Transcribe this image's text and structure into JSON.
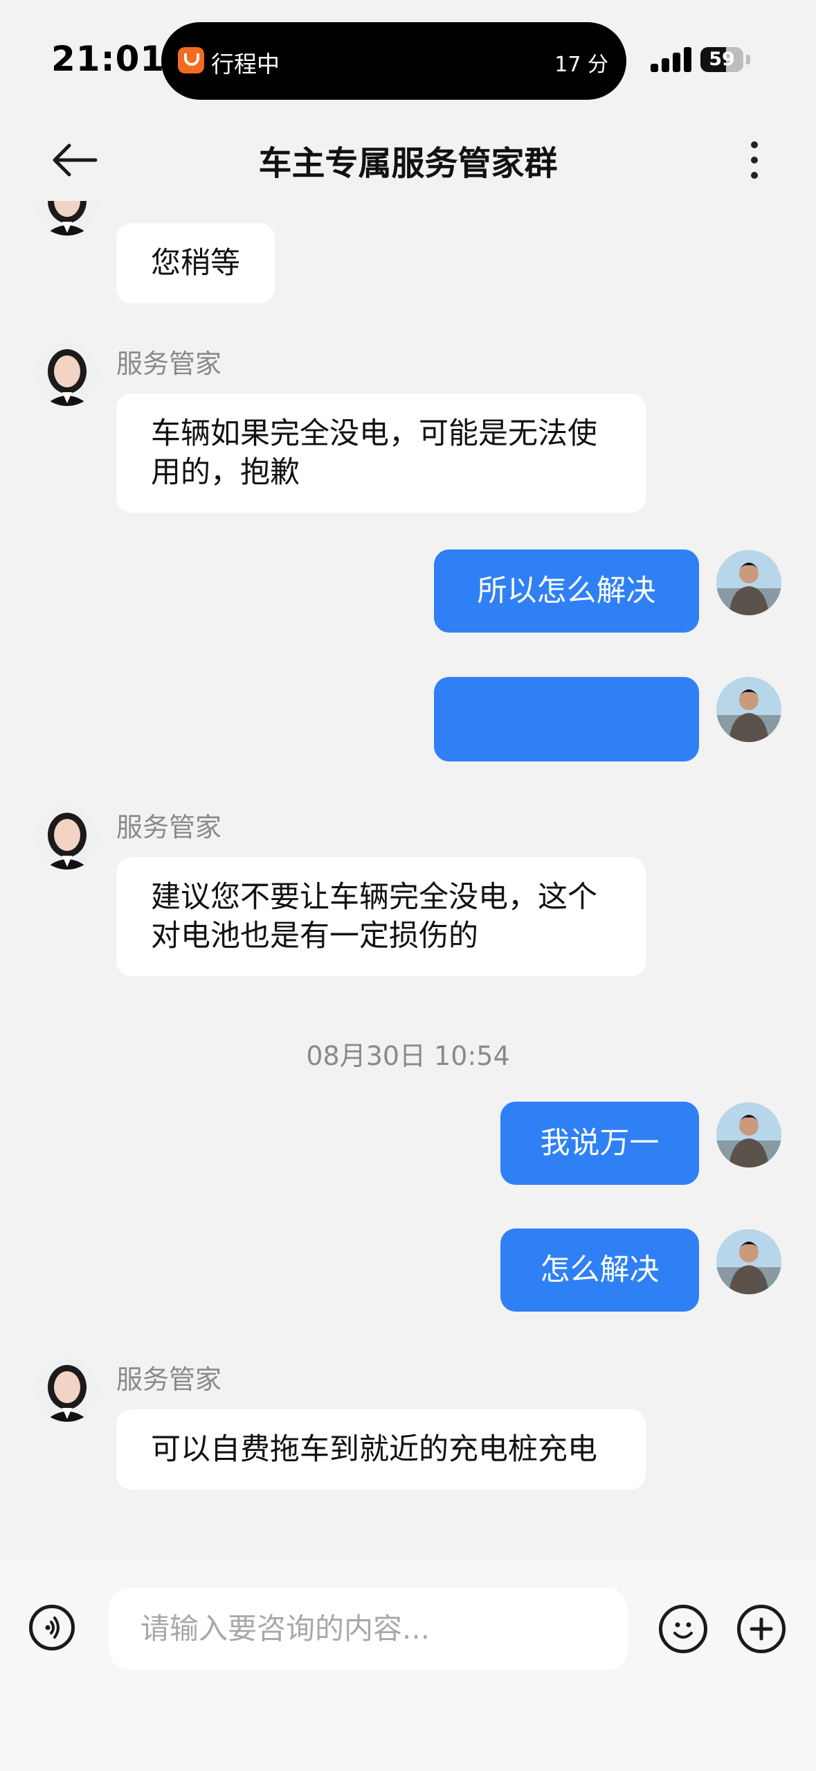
{
  "status_bar": {
    "time": "21:01",
    "activity": "行程中",
    "activity_time": "17 分",
    "battery": "59",
    "battery_level": 0.59
  },
  "header": {
    "title": "车主专属服务管家群"
  },
  "messages": [
    {
      "side": "left",
      "text": "您稍等"
    },
    {
      "side": "left",
      "sender": "服务管家",
      "text": "车辆如果完全没电，可能是无法使用的，抱歉"
    },
    {
      "side": "right",
      "text": "所以怎么解决"
    },
    {
      "side": "right",
      "text": ""
    },
    {
      "side": "left",
      "sender": "服务管家",
      "text": "建议您不要让车辆完全没电，这个对电池也是有一定损伤的"
    },
    {
      "side": "right",
      "text": "我说万一"
    },
    {
      "side": "right",
      "text": "怎么解决"
    },
    {
      "side": "left",
      "sender": "服务管家",
      "text": "可以自费拖车到就近的充电桩充电"
    }
  ],
  "timestamp": "08月30日 10:54",
  "input": {
    "placeholder": "请输入要咨询的内容..."
  },
  "colors": {
    "accent": "#2f80f5",
    "background": "#f2f2f2",
    "bubble_left": "#ffffff"
  },
  "icons": {
    "back": "arrow-left-icon",
    "more": "more-vertical-icon",
    "voice": "voice-icon",
    "emoji": "emoji-icon",
    "plus": "plus-icon"
  }
}
